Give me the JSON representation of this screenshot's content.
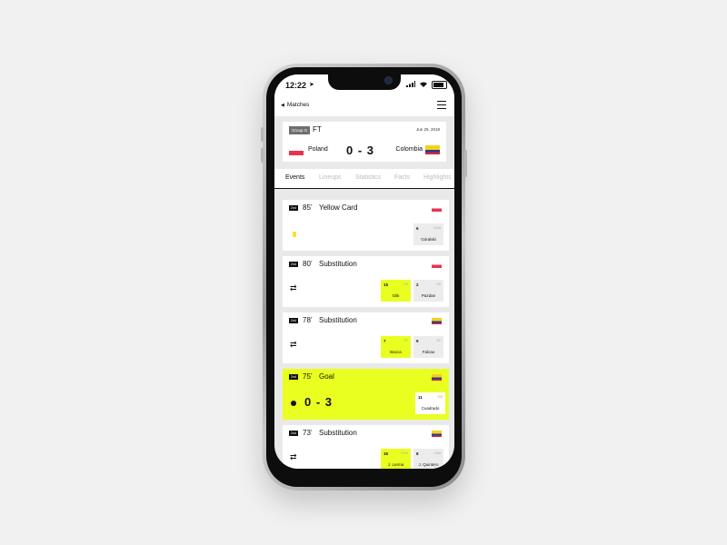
{
  "status": {
    "time": "12:22",
    "location_icon": "location-arrow-icon",
    "signal_icon": "signal-icon",
    "wifi_icon": "wifi-icon",
    "battery_icon": "battery-icon"
  },
  "nav": {
    "back_label": "Matches",
    "back_icon": "chevron-left-icon",
    "menu_icon": "hamburger-menu-icon"
  },
  "match": {
    "group": "Group G",
    "status": "FT",
    "date": "Jun 25, 2018",
    "home": {
      "name": "Poland"
    },
    "away": {
      "name": "Colombia"
    },
    "score": "0 - 3"
  },
  "tabs": [
    {
      "label": "Events",
      "active": true
    },
    {
      "label": "Lineups"
    },
    {
      "label": "Statistics"
    },
    {
      "label": "Facts"
    },
    {
      "label": "Highlights"
    }
  ],
  "events": [
    {
      "half": "2nd",
      "minute": "85’",
      "type": "Yellow Card",
      "team": "Poland",
      "icon": "yellow-card-icon",
      "players": [
        {
          "number": "6",
          "position": "CDM",
          "name": "Góralski"
        }
      ]
    },
    {
      "half": "2nd",
      "minute": "80’",
      "type": "Substitution",
      "team": "Poland",
      "icon": "substitution-icon",
      "players": [
        {
          "number": "15",
          "position": "CB",
          "name": "Glik"
        },
        {
          "number": "2",
          "position": "CB",
          "name": "Pazdan"
        }
      ]
    },
    {
      "half": "2nd",
      "minute": "78’",
      "type": "Substitution",
      "team": "Colombia",
      "icon": "substitution-icon",
      "players": [
        {
          "number": "7",
          "position": "ST",
          "name": "Bacca"
        },
        {
          "number": "9",
          "position": "ST",
          "name": "Falcao"
        }
      ]
    },
    {
      "half": "2nd",
      "minute": "75’",
      "type": "Goal",
      "team": "Colombia",
      "icon": "goal-dot-icon",
      "score": "0 - 3",
      "players": [
        {
          "number": "11",
          "position": "RM",
          "name": "Cuadrado"
        }
      ]
    },
    {
      "half": "2nd",
      "minute": "73’",
      "type": "Substitution",
      "team": "Colombia",
      "icon": "substitution-icon",
      "players": [
        {
          "number": "16",
          "position": "CDM",
          "name": "J. Lerma"
        },
        {
          "number": "8",
          "position": "CAM",
          "name": "J. Quintero"
        }
      ]
    }
  ],
  "colors": {
    "accent": "#e9ff1f",
    "background": "#e9e9e9",
    "card": "#ffffff",
    "text": "#111111"
  }
}
